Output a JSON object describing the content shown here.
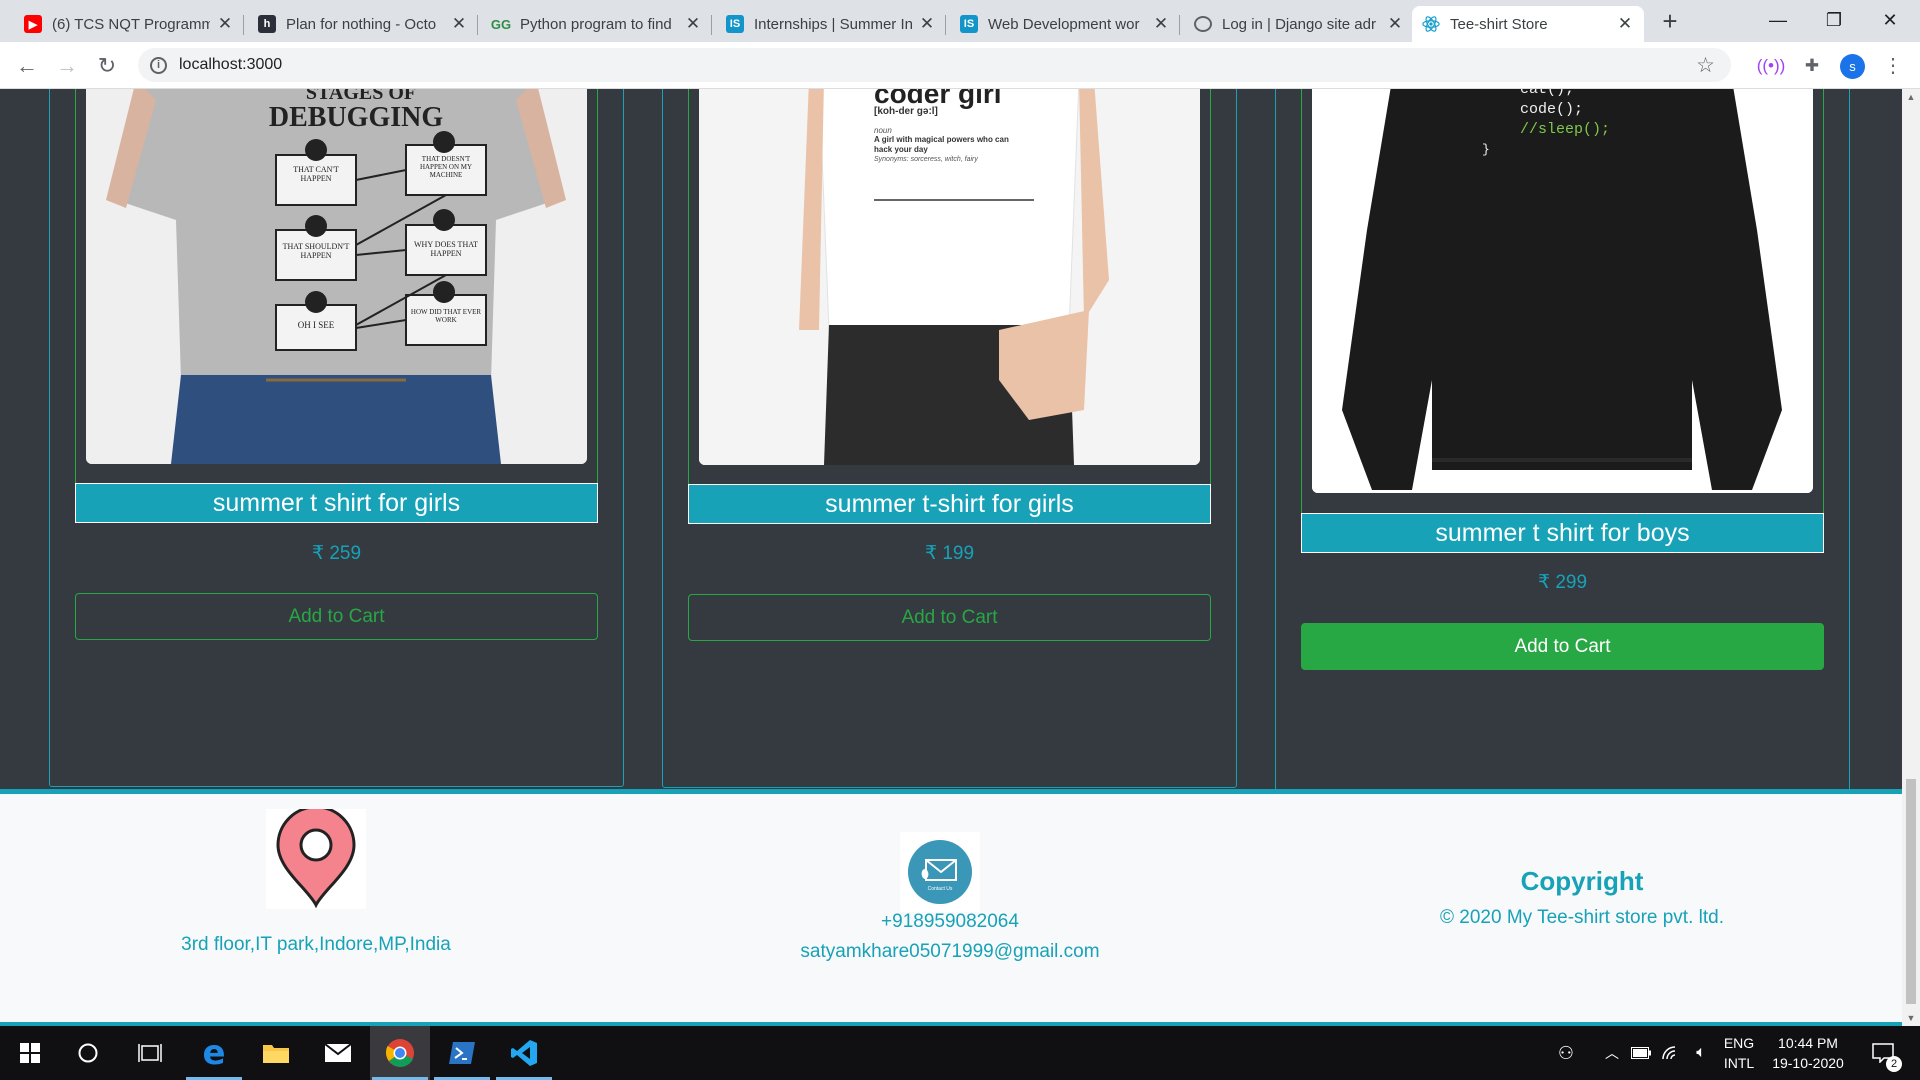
{
  "browser": {
    "tabs": [
      {
        "title": "(6) TCS NQT Programm",
        "favicon": "youtube-icon"
      },
      {
        "title": "Plan for nothing - Octo",
        "favicon": "hashnode-icon"
      },
      {
        "title": "Python program to find",
        "favicon": "geeksforgeeks-icon"
      },
      {
        "title": "Internships | Summer In",
        "favicon": "internshala-icon"
      },
      {
        "title": "Web Development wor",
        "favicon": "internshala-icon"
      },
      {
        "title": "Log in | Django site adr",
        "favicon": "globe-icon"
      },
      {
        "title": "Tee-shirt Store",
        "favicon": "react-icon"
      }
    ],
    "url": "localhost:3000",
    "profile_initial": "s"
  },
  "products": [
    {
      "name": "summer t shirt for girls",
      "price": "₹ 259",
      "button": "Add to Cart",
      "print_text": [
        "STAGES OF",
        "DEBUGGING",
        "THAT CAN'T HAPPEN",
        "THAT DOESN'T HAPPEN ON MY MACHINE",
        "THAT SHOULDN'T HAPPEN",
        "WHY DOES THAT HAPPEN",
        "OH I SEE",
        "HOW DID THAT EVER WORK"
      ]
    },
    {
      "name": "summer t-shirt for girls",
      "price": "₹ 199",
      "button": "Add to Cart",
      "print_text": [
        "coder girl",
        "[koh-der gə:l]",
        "noun",
        "A girl with magical powers who can hack your day",
        "Synonyms: sorceress, witch, fairy"
      ]
    },
    {
      "name": "summer t shirt for boys",
      "price": "₹ 299",
      "button": "Add to Cart",
      "print_text": [
        "eat();",
        "code();",
        "//sleep();",
        "}"
      ]
    }
  ],
  "footer": {
    "address": "3rd floor,IT park,Indore,MP,India",
    "phone": "+918959082064",
    "email": "satyamkhare05071999@gmail.com",
    "contact_badge": "Contact Us",
    "copyright_heading": "Copyright",
    "copyright_text": "© 2020 My Tee-shirt store pvt. ltd."
  },
  "taskbar": {
    "lang_top": "ENG",
    "lang_bottom": "INTL",
    "time": "10:44 PM",
    "date": "19-10-2020",
    "notifications": "2"
  },
  "colors": {
    "page_bg": "#343a40",
    "accent": "#17a2b8",
    "success": "#28a745",
    "footer_bg": "#f8f9fa"
  }
}
